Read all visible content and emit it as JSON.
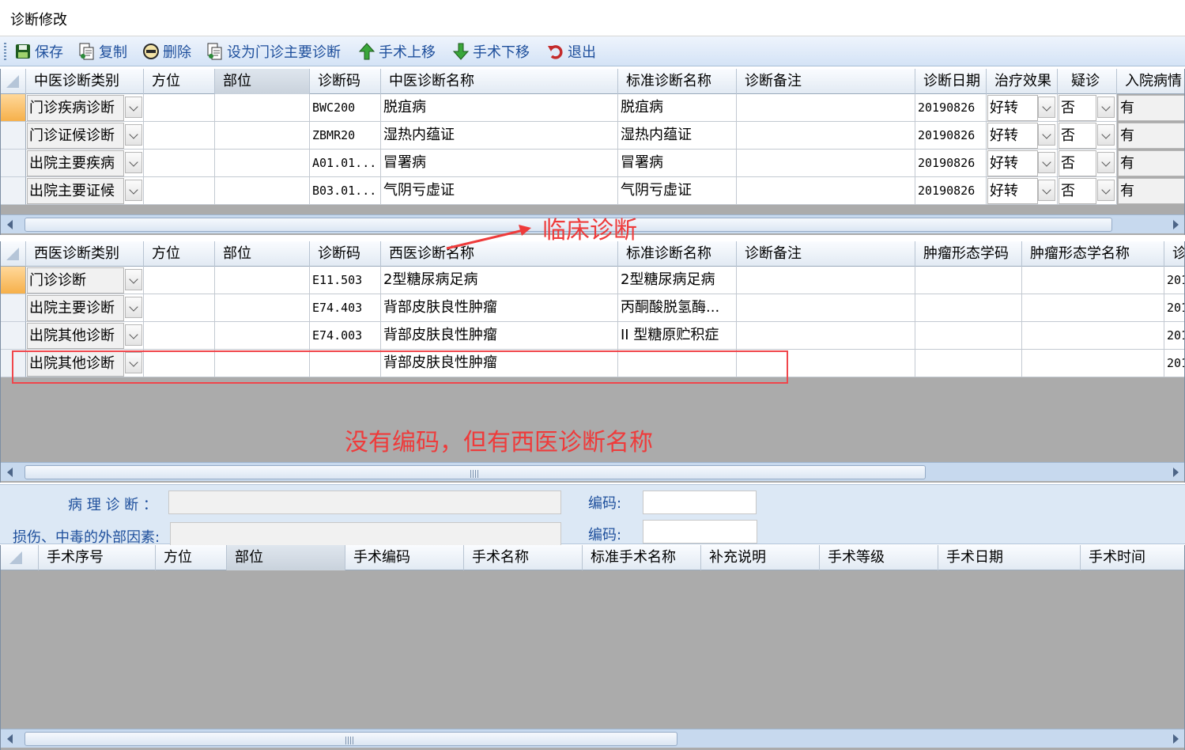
{
  "window": {
    "title": "诊断修改"
  },
  "toolbar": {
    "save": "保存",
    "copy": "复制",
    "delete": "删除",
    "set_main": "设为门诊主要诊断",
    "move_up": "手术上移",
    "move_down": "手术下移",
    "exit": "退出"
  },
  "tcm_grid": {
    "headers": [
      "中医诊断类别",
      "方位",
      "部位",
      "诊断码",
      "中医诊断名称",
      "标准诊断名称",
      "诊断备注",
      "诊断日期",
      "治疗效果",
      "疑诊",
      "入院病情"
    ],
    "rows": [
      {
        "category": "门诊疾病诊断",
        "code": "BWC200",
        "name": "脱疽病",
        "std_name": "脱疽病",
        "date": "20190826",
        "effect": "好转",
        "suspect": "否",
        "admission": "有"
      },
      {
        "category": "门诊证候诊断",
        "code": "ZBMR20",
        "name": "湿热内蕴证",
        "std_name": "湿热内蕴证",
        "date": "20190826",
        "effect": "好转",
        "suspect": "否",
        "admission": "有"
      },
      {
        "category": "出院主要疾病",
        "code": "A01.01...",
        "name": "冒署病",
        "std_name": "冒署病",
        "date": "20190826",
        "effect": "好转",
        "suspect": "否",
        "admission": "有"
      },
      {
        "category": "出院主要证候",
        "code": "B03.01...",
        "name": "气阴亏虚证",
        "std_name": "气阴亏虚证",
        "date": "20190826",
        "effect": "好转",
        "suspect": "否",
        "admission": "有"
      }
    ]
  },
  "wm_grid": {
    "headers": [
      "西医诊断类别",
      "方位",
      "部位",
      "诊断码",
      "西医诊断名称",
      "标准诊断名称",
      "诊断备注",
      "肿瘤形态学码",
      "肿瘤形态学名称",
      "诊"
    ],
    "rows": [
      {
        "category": "门诊诊断",
        "code": "E11.503",
        "name": "2型糖尿病足病",
        "std_name": "2型糖尿病足病",
        "tail": "201"
      },
      {
        "category": "出院主要诊断",
        "code": "E74.403",
        "name": "背部皮肤良性肿瘤",
        "std_name": "丙酮酸脱氢酶...",
        "tail": "201"
      },
      {
        "category": "出院其他诊断",
        "code": "E74.003",
        "name": "背部皮肤良性肿瘤",
        "std_name": "II 型糖原贮积症",
        "tail": "201"
      },
      {
        "category": "出院其他诊断",
        "code": "",
        "name": "背部皮肤良性肿瘤",
        "std_name": "",
        "tail": "201"
      }
    ]
  },
  "pathology": {
    "path_label": "病 理 诊 断 ：",
    "injury_label": "损伤、中毒的外部因素:",
    "code_label1": "编码:",
    "code_label2": "编码:"
  },
  "surgery_grid": {
    "headers": [
      "手术序号",
      "方位",
      "部位",
      "手术编码",
      "手术名称",
      "标准手术名称",
      "补充说明",
      "手术等级",
      "手术日期",
      "手术时间"
    ]
  },
  "annotations": {
    "clinical": "临床诊断",
    "note": "没有编码，但有西医诊断名称"
  },
  "colors": {
    "annotation": "#ee3b3b",
    "toolbar_text": "#1e4f9c"
  }
}
